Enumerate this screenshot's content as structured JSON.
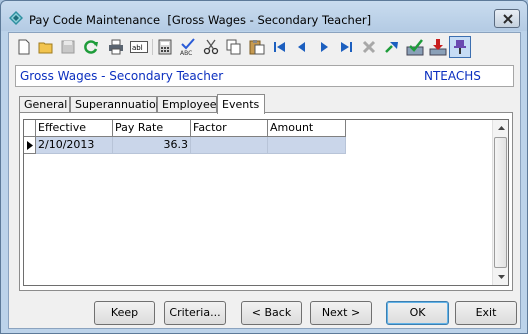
{
  "window": {
    "app_title": "Pay Code Maintenance",
    "record_title": "[Gross Wages - Secondary Teacher]"
  },
  "toolbar": {
    "buttons": [
      {
        "name": "new-icon"
      },
      {
        "name": "open-icon"
      },
      {
        "name": "save-icon"
      },
      {
        "name": "refresh-icon"
      },
      {
        "name": "print-icon"
      },
      {
        "name": "text-field-icon"
      },
      {
        "name": "calculator-icon"
      },
      {
        "name": "spellcheck-icon"
      },
      {
        "name": "cut-icon"
      },
      {
        "name": "copy-icon"
      },
      {
        "name": "paste-icon"
      },
      {
        "name": "first-record-icon"
      },
      {
        "name": "previous-record-icon"
      },
      {
        "name": "next-record-icon"
      },
      {
        "name": "last-record-icon"
      },
      {
        "name": "delete-icon"
      },
      {
        "name": "go-to-icon"
      },
      {
        "name": "approve-icon"
      },
      {
        "name": "download-icon"
      },
      {
        "name": "pin-icon"
      }
    ]
  },
  "header": {
    "name": "Gross Wages - Secondary Teacher",
    "code": "NTEACHS"
  },
  "tabs": [
    {
      "label": "General",
      "active": false
    },
    {
      "label": "Superannuation",
      "active": false
    },
    {
      "label": "Employees",
      "active": false
    },
    {
      "label": "Events",
      "active": true
    }
  ],
  "grid": {
    "columns": [
      "Effective",
      "Pay Rate",
      "Factor",
      "Amount"
    ],
    "rows": [
      {
        "effective": "2/10/2013",
        "pay_rate": "36.3",
        "factor": "",
        "amount": ""
      }
    ]
  },
  "buttons": {
    "keep": "Keep",
    "criteria": "Criteria...",
    "back": "< Back",
    "next": "Next >",
    "ok": "OK",
    "exit": "Exit"
  }
}
